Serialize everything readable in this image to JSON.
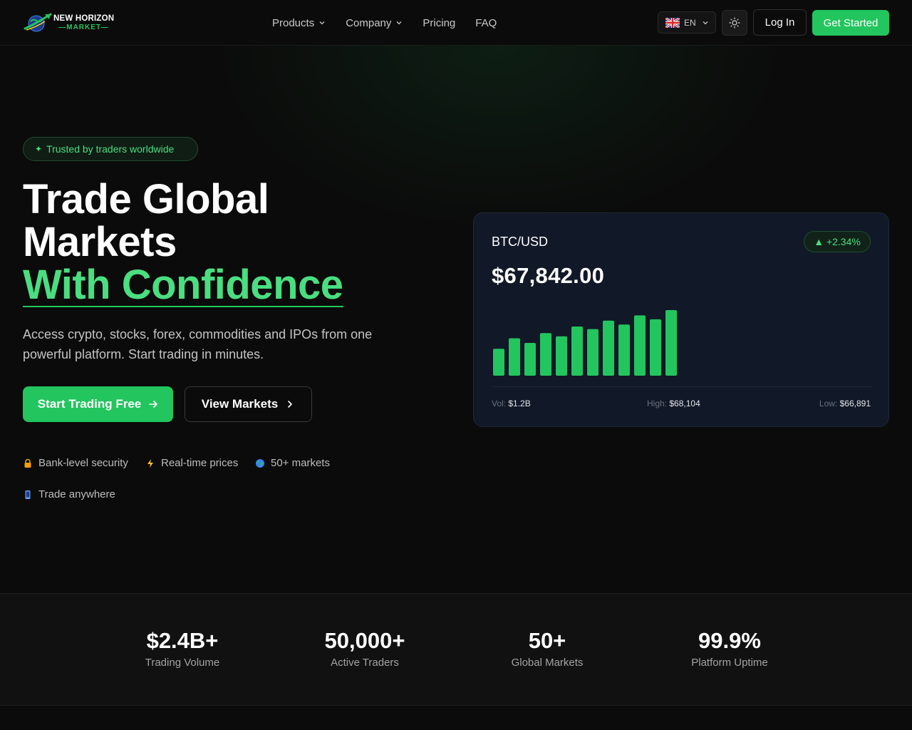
{
  "header": {
    "logo": {
      "line1": "NEW HORIZON",
      "line2": "MARKET"
    },
    "nav": [
      {
        "label": "Products",
        "has_dropdown": true
      },
      {
        "label": "Company",
        "has_dropdown": true
      },
      {
        "label": "Pricing",
        "has_dropdown": false
      },
      {
        "label": "FAQ",
        "has_dropdown": false
      }
    ],
    "language": {
      "code": "EN",
      "flag": "uk-flag-icon"
    },
    "theme_toggle_icon": "sun-icon",
    "login_label": "Log In",
    "get_started_label": "Get Started"
  },
  "hero": {
    "badge": "Trusted by traders worldwide",
    "badge_icon": "sparkle-icon",
    "title_line1": "Trade Global",
    "title_line2": "Markets",
    "title_accent": "With Confidence",
    "subtitle": "Access crypto, stocks, forex, commodities and IPOs from one powerful platform. Start trading in minutes.",
    "cta_primary": "Start Trading Free",
    "cta_secondary": "View Markets",
    "features": [
      {
        "icon": "lock-icon",
        "label": "Bank-level security"
      },
      {
        "icon": "lightning-icon",
        "label": "Real-time prices"
      },
      {
        "icon": "globe-icon",
        "label": "50+ markets"
      },
      {
        "icon": "mobile-phone-icon",
        "label": "Trade anywhere"
      }
    ]
  },
  "ticker_card": {
    "symbol": "BTC/USD",
    "change": "+2.34%",
    "change_prefix": "▲",
    "price": "$67,842.00",
    "stats": {
      "vol_label": "Vol:",
      "vol_value": "$1.2B",
      "high_label": "High:",
      "high_value": "$68,104",
      "low_label": "Low:",
      "low_value": "$66,891"
    }
  },
  "chart_data": {
    "type": "bar",
    "title": "",
    "xlabel": "",
    "ylabel": "",
    "ylim": [
      0,
      100
    ],
    "values": [
      41,
      57,
      50,
      65,
      60,
      75,
      71,
      84,
      78,
      92,
      86,
      100
    ]
  },
  "stats": [
    {
      "value": "$2.4B+",
      "label": "Trading Volume"
    },
    {
      "value": "50,000+",
      "label": "Active Traders"
    },
    {
      "value": "50+",
      "label": "Global Markets"
    },
    {
      "value": "99.9%",
      "label": "Platform Uptime"
    }
  ],
  "colors": {
    "accent": "#22c55e",
    "accent_text": "#4ade80",
    "background": "#0b0b0b",
    "card": "#111827"
  }
}
